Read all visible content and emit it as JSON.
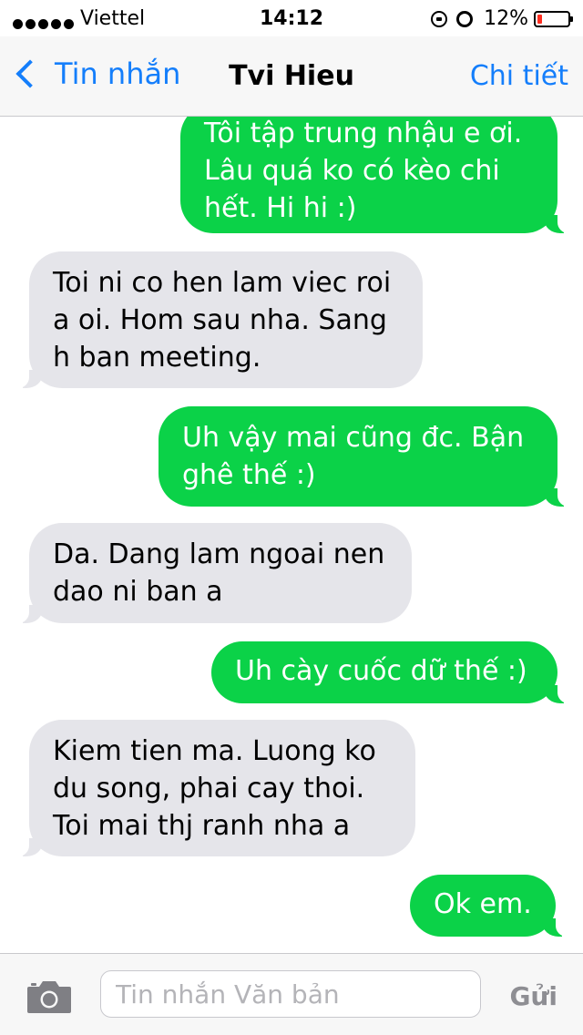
{
  "status_bar": {
    "signal_bars": 5,
    "carrier": "Viettel",
    "time": "14:12",
    "battery_percent": "12%",
    "battery_level": 0.12,
    "battery_color": "#ff2d1f"
  },
  "nav": {
    "back_label": "Tin nhắn",
    "title": "Tvi Hieu",
    "detail_label": "Chi tiết",
    "accent_color": "#147efb"
  },
  "messages": [
    {
      "direction": "outgoing",
      "text": "Tôi tập trung nhậu e ơi. Lâu quá ko có kèo chi hết. Hi hi :)"
    },
    {
      "direction": "incoming",
      "text": "Toi ni co hen lam viec roi a oi. Hom sau nha. Sang h ban meeting."
    },
    {
      "direction": "outgoing",
      "text": "Uh vậy mai cũng đc. Bận ghê thế :)"
    },
    {
      "direction": "incoming",
      "text": "Da. Dang lam ngoai nen dao ni ban a"
    },
    {
      "direction": "outgoing",
      "text": "Uh cày cuốc dữ thế :)"
    },
    {
      "direction": "incoming",
      "text": "Kiem  tien ma. Luong ko du song, phai cay thoi. Toi mai thj ranh nha a"
    },
    {
      "direction": "outgoing",
      "text": "Ok em."
    }
  ],
  "colors": {
    "outgoing_bubble": "#0bd248",
    "incoming_bubble": "#e5e5ea"
  },
  "input_bar": {
    "camera_icon": "camera-icon",
    "placeholder": "Tin nhắn Văn bản",
    "send_label": "Gửi"
  }
}
